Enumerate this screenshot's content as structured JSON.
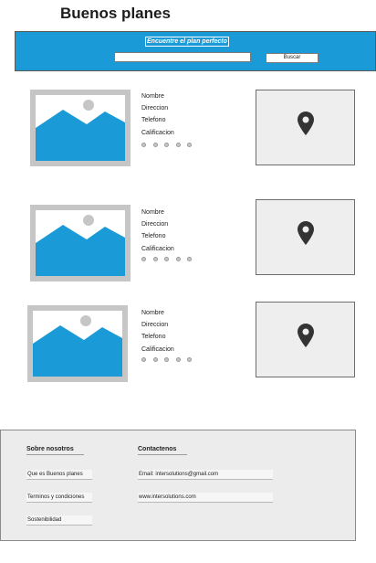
{
  "header": {
    "title": "Buenos planes"
  },
  "banner": {
    "title": "Encuentre el plan perfecto",
    "search_value": "",
    "search_placeholder": "",
    "search_button": "Buscar"
  },
  "results": [
    {
      "name_label": "Nombre",
      "address_label": "Direccion",
      "phone_label": "Telefono",
      "rating_label": "Calificacion",
      "rating_value": 0,
      "rating_max": 5,
      "image_icon": "image-placeholder-icon",
      "map_icon": "map-pin-icon"
    },
    {
      "name_label": "Nombre",
      "address_label": "Direccion",
      "phone_label": "Telefono",
      "rating_label": "Calificacion",
      "rating_value": 0,
      "rating_max": 5,
      "image_icon": "image-placeholder-icon",
      "map_icon": "map-pin-icon"
    },
    {
      "name_label": "Nombre",
      "address_label": "Direccion",
      "phone_label": "Telefono",
      "rating_label": "Calificacion",
      "rating_value": 0,
      "rating_max": 5,
      "image_icon": "image-placeholder-icon",
      "map_icon": "map-pin-icon"
    }
  ],
  "footer": {
    "about": {
      "heading": "Sobre nosotros",
      "links": [
        "Que es Buenos planes",
        "Terminos y condiciones",
        "Sostenibilidad"
      ]
    },
    "contact": {
      "heading": "Contactenos",
      "items": [
        "Email: intersolutions@gmail.com",
        "www.intersolutions.com"
      ]
    }
  },
  "colors": {
    "accent": "#1a9ad6",
    "image_frame": "#c6c6c6",
    "map_background": "#eeeeee",
    "pin": "#333333",
    "footer_background": "#ececec"
  }
}
